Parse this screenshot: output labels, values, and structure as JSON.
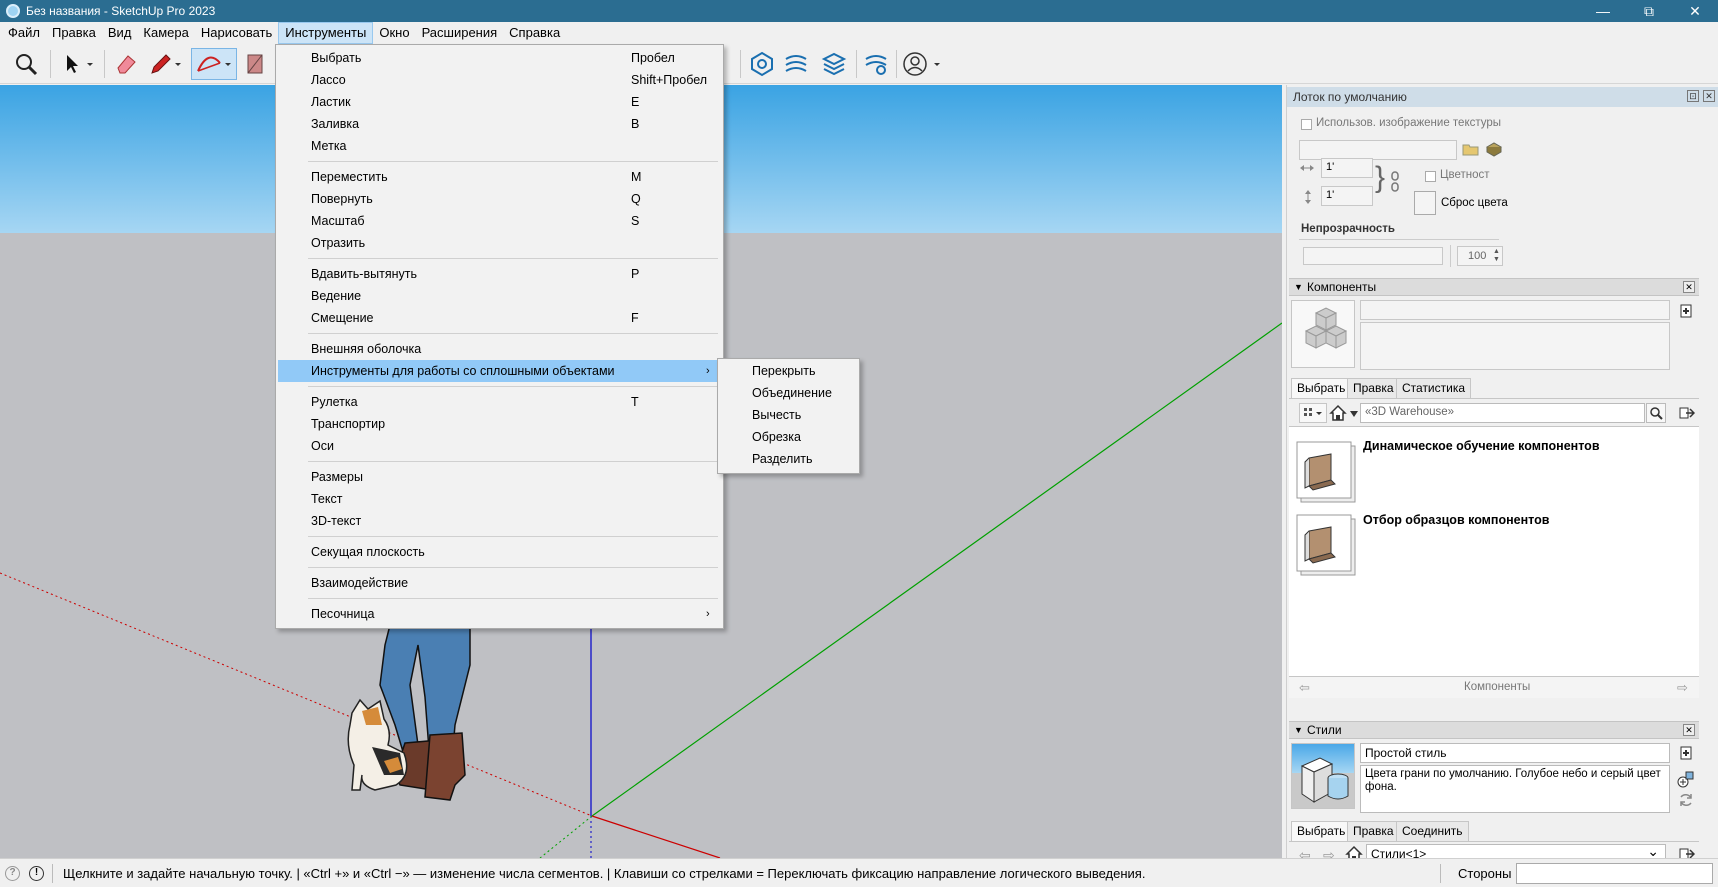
{
  "window": {
    "title": "Без названия - SketchUp Pro 2023",
    "controls": [
      "minimize",
      "maximize",
      "close"
    ]
  },
  "menubar": {
    "items": [
      "Файл",
      "Правка",
      "Вид",
      "Камера",
      "Нарисовать",
      "Инструменты",
      "Окно",
      "Расширения",
      "Справка"
    ],
    "active_index": 5
  },
  "toolbar": {
    "icons": [
      "zoom-icon",
      "select-arrow-icon",
      "eraser-icon",
      "pencil-icon",
      "arc-icon",
      "paint-icon",
      "warehouse-search-icon",
      "sandbox-icon",
      "layers-icon",
      "settings-icon",
      "account-icon"
    ]
  },
  "tools_menu": {
    "groups": [
      [
        {
          "label": "Выбрать",
          "shortcut": "Пробел"
        },
        {
          "label": "Лассо",
          "shortcut": "Shift+Пробел"
        },
        {
          "label": "Ластик",
          "shortcut": "E"
        },
        {
          "label": "Заливка",
          "shortcut": "B"
        },
        {
          "label": "Метка",
          "shortcut": ""
        }
      ],
      [
        {
          "label": "Переместить",
          "shortcut": "M"
        },
        {
          "label": "Повернуть",
          "shortcut": "Q"
        },
        {
          "label": "Масштаб",
          "shortcut": "S"
        },
        {
          "label": "Отразить",
          "shortcut": ""
        }
      ],
      [
        {
          "label": "Вдавить-вытянуть",
          "shortcut": "P"
        },
        {
          "label": "Ведение",
          "shortcut": ""
        },
        {
          "label": "Смещение",
          "shortcut": "F"
        }
      ],
      [
        {
          "label": "Внешняя оболочка",
          "shortcut": ""
        },
        {
          "label": "Инструменты для работы со сплошными объектами",
          "shortcut": "",
          "submenu": true,
          "highlighted": true
        }
      ],
      [
        {
          "label": "Рулетка",
          "shortcut": "T"
        },
        {
          "label": "Транспортир",
          "shortcut": ""
        },
        {
          "label": "Оси",
          "shortcut": ""
        }
      ],
      [
        {
          "label": "Размеры",
          "shortcut": ""
        },
        {
          "label": "Текст",
          "shortcut": ""
        },
        {
          "label": "3D-текст",
          "shortcut": ""
        }
      ],
      [
        {
          "label": "Секущая плоскость",
          "shortcut": ""
        }
      ],
      [
        {
          "label": "Взаимодействие",
          "shortcut": ""
        }
      ],
      [
        {
          "label": "Песочница",
          "shortcut": "",
          "submenu": true
        }
      ]
    ]
  },
  "solid_submenu": {
    "items": [
      "Перекрыть",
      "Объединение",
      "Вычесть",
      "Обрезка",
      "Разделить"
    ]
  },
  "tray": {
    "title": "Лоток по умолчанию",
    "materials": {
      "use_texture_label": "Использов. изображение текстуры",
      "width_value": "1'",
      "height_value": "1'",
      "colorize_label": "Цветност",
      "reset_color_label": "Сброс цвета",
      "opacity_label": "Непрозрачность",
      "opacity_value": "100"
    },
    "components": {
      "header": "Компоненты",
      "tabs": [
        "Выбрать",
        "Правка",
        "Статистика"
      ],
      "search_placeholder": "«3D Warehouse»",
      "items": [
        "Динамическое обучение компонентов",
        "Отбор образцов компонентов"
      ],
      "nav_label": "Компоненты"
    },
    "styles": {
      "header": "Стили",
      "style_name": "Простой стиль",
      "style_description": "Цвета грани по умолчанию. Голубое небо и серый цвет фона.",
      "tabs": [
        "Выбрать",
        "Правка",
        "Соединить"
      ],
      "collection": "Стили<1>"
    }
  },
  "statusbar": {
    "message": "Щелкните и задайте начальную точку. | «Ctrl +» и «Ctrl −» — изменение числа сегментов. | Клавиши со стрелками = Переключать фиксацию направление логического выведения.",
    "vcb_label": "Стороны",
    "vcb_value": ""
  },
  "colors": {
    "titlebar": "#2b6d91",
    "menu_highlight": "#91c9f7",
    "sky_top": "#3aa3e3",
    "ground": "#bfc0c4",
    "axis_red": "#cc0000",
    "axis_green": "#00a000",
    "axis_blue": "#0000cc"
  }
}
